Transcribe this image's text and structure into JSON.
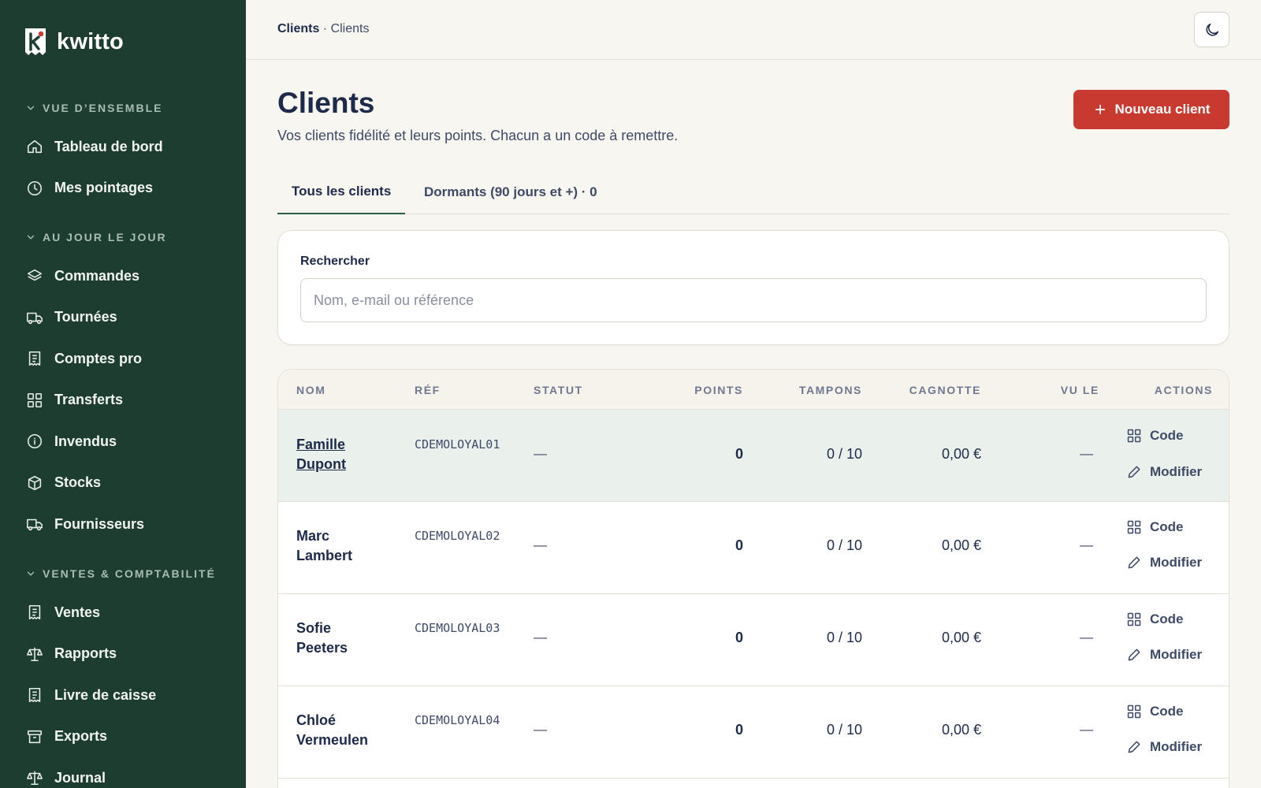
{
  "brand": {
    "name": "kwitto"
  },
  "sidebar": {
    "sections": [
      {
        "title": "VUE D’ENSEMBLE",
        "items": [
          {
            "label": "Tableau de bord",
            "icon": "home-icon"
          },
          {
            "label": "Mes pointages",
            "icon": "clock-icon"
          }
        ]
      },
      {
        "title": "AU JOUR LE JOUR",
        "items": [
          {
            "label": "Commandes",
            "icon": "layers-icon"
          },
          {
            "label": "Tournées",
            "icon": "truck-icon"
          },
          {
            "label": "Comptes pro",
            "icon": "receipt-icon"
          },
          {
            "label": "Transferts",
            "icon": "grid-icon"
          },
          {
            "label": "Invendus",
            "icon": "info-icon"
          },
          {
            "label": "Stocks",
            "icon": "box-icon"
          },
          {
            "label": "Fournisseurs",
            "icon": "truck-icon"
          }
        ]
      },
      {
        "title": "VENTES & COMPTABILITÉ",
        "items": [
          {
            "label": "Ventes",
            "icon": "receipt-icon"
          },
          {
            "label": "Rapports",
            "icon": "scale-icon"
          },
          {
            "label": "Livre de caisse",
            "icon": "receipt-icon"
          },
          {
            "label": "Exports",
            "icon": "archive-icon"
          },
          {
            "label": "Journal",
            "icon": "scale-icon"
          }
        ]
      }
    ]
  },
  "header": {
    "breadcrumb_root": "Clients",
    "breadcrumb_sep": " · ",
    "breadcrumb_current": "Clients",
    "theme_icon": "moon-icon"
  },
  "page": {
    "title": "Clients",
    "subtitle": "Vos clients fidélité et leurs points. Chacun a un code à remettre.",
    "new_button": "Nouveau client"
  },
  "tabs": [
    {
      "label": "Tous les clients",
      "active": true
    },
    {
      "label": "Dormants (90 jours et +) · 0",
      "active": false
    }
  ],
  "search": {
    "label": "Rechercher",
    "placeholder": "Nom, e-mail ou référence",
    "value": ""
  },
  "table": {
    "columns": [
      "NOM",
      "RÉF",
      "STATUT",
      "POINTS",
      "TAMPONS",
      "CAGNOTTE",
      "VU LE",
      "ACTIONS"
    ],
    "action_code": "Code",
    "action_edit": "Modifier",
    "rows": [
      {
        "name": "Famille Dupont",
        "ref": "CDEMOLOYAL01",
        "status": "—",
        "points": "0",
        "stamps": "0 / 10",
        "pot": "0,00 €",
        "seen": "—"
      },
      {
        "name": "Marc Lambert",
        "ref": "CDEMOLOYAL02",
        "status": "—",
        "points": "0",
        "stamps": "0 / 10",
        "pot": "0,00 €",
        "seen": "—"
      },
      {
        "name": "Sofie Peeters",
        "ref": "CDEMOLOYAL03",
        "status": "—",
        "points": "0",
        "stamps": "0 / 10",
        "pot": "0,00 €",
        "seen": "—"
      },
      {
        "name": "Chloé Vermeulen",
        "ref": "CDEMOLOYAL04",
        "status": "—",
        "points": "0",
        "stamps": "0 / 10",
        "pot": "0,00 €",
        "seen": "—"
      }
    ]
  },
  "colors": {
    "sidebar_bg": "#1d3d30",
    "accent_red": "#c83a2f",
    "accent_green": "#2b5d45",
    "text_navy": "#1e2a4a",
    "highlight_row": "#eaf0ec"
  }
}
